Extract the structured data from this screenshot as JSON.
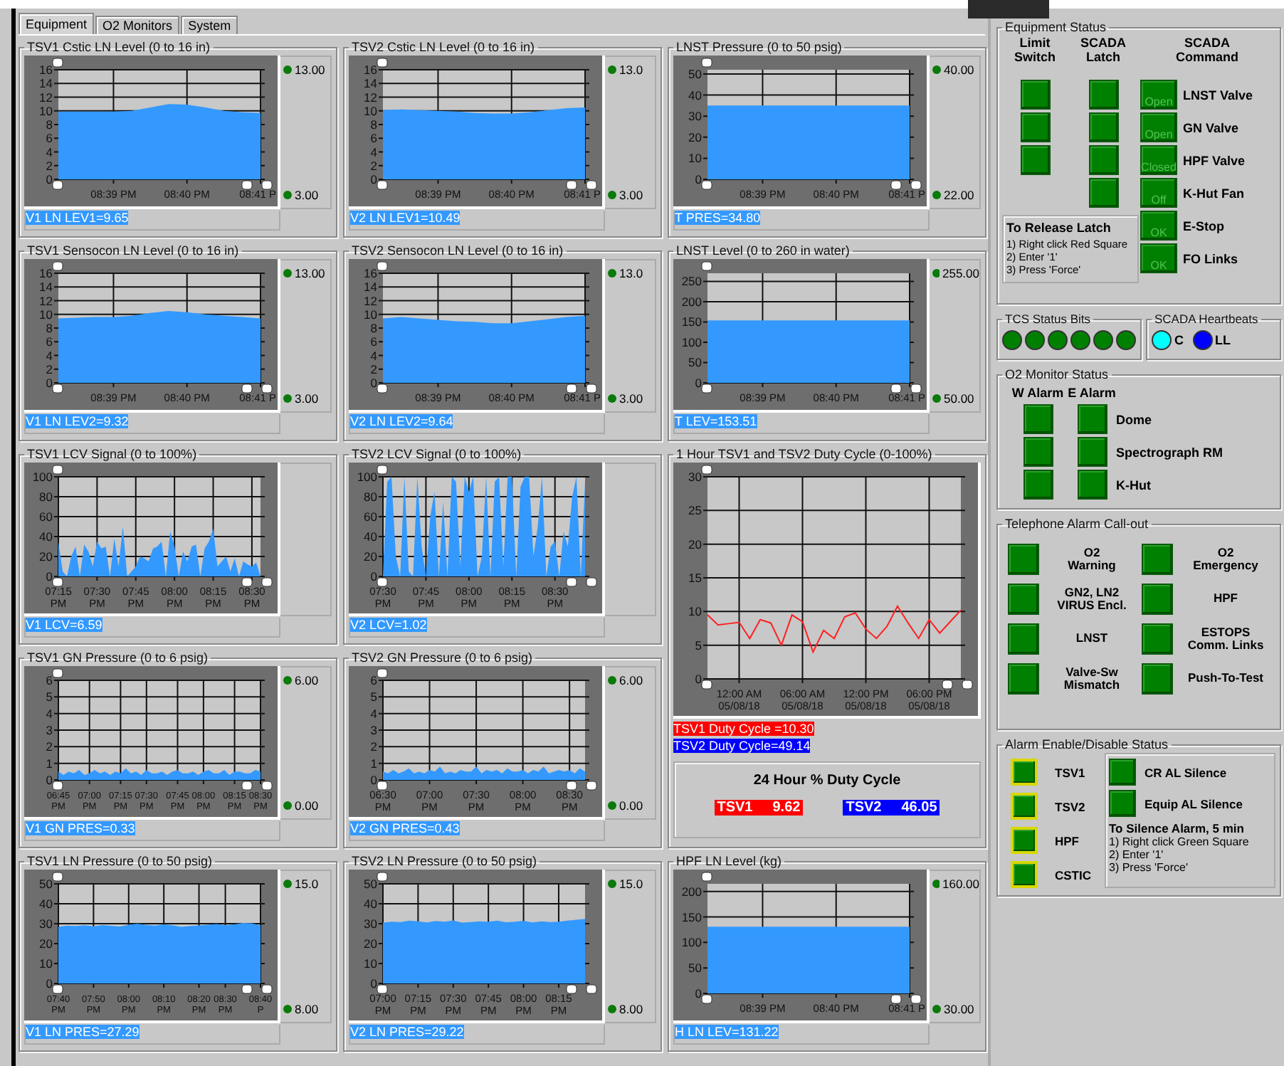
{
  "tabs": [
    {
      "label": "Equipment",
      "selected": true
    },
    {
      "label": "O2 Monitors",
      "selected": false
    },
    {
      "label": "System",
      "selected": false
    }
  ],
  "columns": [
    [
      {
        "kind": "trend",
        "title": "TSV1 Cstic LN Level (0 to 16 in)",
        "high_limit": "13.00",
        "low_limit": "3.00",
        "readout": "V1 LN LEV1=9.65",
        "chart_data": {
          "type": "area",
          "grid": true,
          "categories": [
            null,
            null,
            null,
            "08:39 PM",
            null,
            null,
            null,
            "08:40 PM",
            null,
            null,
            null,
            "08:41 P"
          ],
          "values": [
            9.9,
            9.9,
            9.9,
            9.9,
            10,
            10.5,
            11,
            10.9,
            10.5,
            10,
            9.8,
            9.7
          ],
          "ylim": [
            0,
            16
          ],
          "yticks": [
            0,
            2,
            4,
            6,
            8,
            10,
            12,
            14,
            16
          ]
        }
      },
      {
        "kind": "trend",
        "title": "TSV1 Sensocon LN Level (0 to 16 in)",
        "high_limit": "13.00",
        "low_limit": "3.00",
        "readout": "V1 LN LEV2=9.32",
        "chart_data": {
          "type": "area",
          "grid": true,
          "categories": [
            null,
            null,
            null,
            "08:39 PM",
            null,
            null,
            null,
            "08:40 PM",
            null,
            null,
            null,
            "08:41 P"
          ],
          "values": [
            9.4,
            9.5,
            9.6,
            9.6,
            9.8,
            10.2,
            10.5,
            10.3,
            10,
            9.8,
            9.6,
            9.4
          ],
          "ylim": [
            0,
            16
          ],
          "yticks": [
            0,
            2,
            4,
            6,
            8,
            10,
            12,
            14,
            16
          ]
        }
      },
      {
        "kind": "trend",
        "title": "TSV1 LCV Signal (0 to 100%)",
        "readout": "V1 LCV=6.59",
        "chart_data": {
          "type": "area",
          "grid": true,
          "categories": [
            "07:15 PM",
            null,
            null,
            null,
            null,
            null,
            null,
            null,
            null,
            "07:30 PM",
            null,
            null,
            null,
            null,
            null,
            null,
            null,
            null,
            "07:45 PM",
            null,
            null,
            null,
            null,
            null,
            null,
            null,
            null,
            "08:00 PM",
            null,
            null,
            null,
            null,
            null,
            null,
            null,
            null,
            "08:15 PM",
            null,
            null,
            null,
            null,
            null,
            null,
            null,
            null,
            "08:30 PM",
            null,
            null
          ],
          "values": [
            35,
            5,
            0,
            20,
            30,
            0,
            32,
            25,
            10,
            35,
            28,
            30,
            0,
            38,
            10,
            50,
            0,
            5,
            10,
            20,
            18,
            15,
            28,
            30,
            35,
            0,
            45,
            30,
            0,
            25,
            15,
            30,
            32,
            0,
            28,
            35,
            48,
            10,
            15,
            20,
            5,
            18,
            0,
            15,
            12,
            10,
            14,
            0
          ],
          "ylim": [
            0,
            100
          ],
          "yticks": [
            0,
            20,
            40,
            60,
            80,
            100
          ]
        }
      },
      {
        "kind": "trend",
        "title": "TSV1 GN Pressure (0 to 6 psig)",
        "high_limit": "6.00",
        "low_limit": "0.00",
        "readout": "V1 GN PRES=0.33",
        "chart_data": {
          "type": "area",
          "grid": true,
          "categories": [
            "06:45 PM",
            null,
            null,
            null,
            null,
            null,
            "07:00 PM",
            null,
            null,
            null,
            null,
            null,
            "07:15 PM",
            null,
            null,
            null,
            null,
            "07:30 PM",
            null,
            null,
            null,
            null,
            null,
            "07:45 PM",
            null,
            null,
            null,
            null,
            "08:00 PM",
            null,
            null,
            null,
            null,
            null,
            "08:15 PM",
            null,
            null,
            null,
            null,
            "08:30 PM"
          ],
          "values": [
            0.5,
            0.3,
            0.5,
            0.4,
            0.6,
            0.3,
            0.4,
            0.6,
            0.4,
            0.5,
            0.3,
            0.5,
            0.4,
            0.7,
            0.4,
            0.5,
            0.3,
            0.6,
            0.4,
            0.4,
            0.5,
            0.3,
            0.5,
            0.6,
            0.4,
            0.4,
            0.5,
            0.3,
            0.5,
            0.6,
            0.4,
            0.4,
            0.6,
            0.3,
            0.5,
            0.5,
            0.4,
            0.4,
            0.6,
            0.5
          ],
          "ylim": [
            0,
            6
          ],
          "yticks": [
            0,
            1,
            2,
            3,
            4,
            5,
            6
          ]
        }
      },
      {
        "kind": "trend",
        "title": "TSV1 LN Pressure (0 to 50 psig)",
        "high_limit": "15.0",
        "low_limit": "8.00",
        "readout": "V1 LN PRES=27.29",
        "chart_data": {
          "type": "area",
          "grid": true,
          "categories": [
            "07:40 PM",
            null,
            null,
            null,
            "07:50 PM",
            null,
            null,
            null,
            "08:00 PM",
            null,
            null,
            null,
            "08:10 PM",
            null,
            null,
            null,
            "08:20 PM",
            null,
            null,
            "08:30 PM",
            null,
            null,
            null,
            "08:40 P"
          ],
          "values": [
            28.5,
            29,
            28.8,
            29.2,
            28.7,
            29.3,
            28.9,
            28.6,
            29.5,
            30,
            29.4,
            29,
            29.6,
            29.2,
            28.4,
            28.8,
            29.1,
            29.5,
            29.8,
            29.3,
            29.6,
            30.4,
            30.2,
            29.2
          ],
          "ylim": [
            0,
            50
          ],
          "yticks": [
            0,
            10,
            20,
            30,
            40,
            50
          ]
        }
      }
    ],
    [
      {
        "kind": "trend",
        "title": "TSV2 Cstic LN Level (0 to 16 in)",
        "high_limit": "13.0",
        "low_limit": "3.00",
        "readout": "V2 LN LEV1=10.49",
        "chart_data": {
          "type": "area",
          "grid": true,
          "categories": [
            null,
            null,
            null,
            "08:39 PM",
            null,
            null,
            null,
            "08:40 PM",
            null,
            null,
            null,
            "08:41 P"
          ],
          "values": [
            10.1,
            10.2,
            10.1,
            10,
            9.9,
            9.7,
            9.6,
            9.6,
            9.8,
            10.1,
            10.4,
            10.5
          ],
          "ylim": [
            0,
            16
          ],
          "yticks": [
            0,
            2,
            4,
            6,
            8,
            10,
            12,
            14,
            16
          ]
        }
      },
      {
        "kind": "trend",
        "title": "TSV2 Sensocon LN Level (0 to 16 in)",
        "high_limit": "13.0",
        "low_limit": "3.00",
        "readout": "V2 LN LEV2=9.64",
        "chart_data": {
          "type": "area",
          "grid": true,
          "categories": [
            null,
            null,
            null,
            "08:39 PM",
            null,
            null,
            null,
            "08:40 PM",
            null,
            null,
            null,
            "08:41 P"
          ],
          "values": [
            9.4,
            9.6,
            9.4,
            9.2,
            9,
            8.9,
            8.7,
            8.7,
            9,
            9.3,
            9.6,
            9.8
          ],
          "ylim": [
            0,
            16
          ],
          "yticks": [
            0,
            2,
            4,
            6,
            8,
            10,
            12,
            14,
            16
          ]
        }
      },
      {
        "kind": "trend",
        "title": "TSV2 LCV Signal (0 to 100%)",
        "readout": "V2 LCV=1.02",
        "chart_data": {
          "type": "area",
          "grid": true,
          "categories": [
            "07:30 PM",
            null,
            null,
            null,
            null,
            null,
            null,
            null,
            null,
            null,
            "07:45 PM",
            null,
            null,
            null,
            null,
            null,
            null,
            null,
            null,
            null,
            "08:00 PM",
            null,
            null,
            null,
            null,
            null,
            null,
            null,
            null,
            null,
            "08:15 PM",
            null,
            null,
            null,
            null,
            null,
            null,
            null,
            null,
            null,
            "08:30 PM",
            null,
            null,
            null,
            null,
            null,
            null,
            null
          ],
          "values": [
            0,
            95,
            100,
            20,
            0,
            100,
            5,
            0,
            100,
            30,
            0,
            60,
            85,
            0,
            75,
            0,
            100,
            95,
            10,
            100,
            85,
            100,
            0,
            20,
            100,
            0,
            95,
            100,
            10,
            100,
            100,
            0,
            90,
            100,
            100,
            20,
            50,
            100,
            0,
            30,
            35,
            0,
            45,
            30,
            80,
            100,
            0,
            95
          ],
          "ylim": [
            0,
            100
          ],
          "yticks": [
            0,
            20,
            40,
            60,
            80,
            100
          ]
        }
      },
      {
        "kind": "trend",
        "title": "TSV2 GN Pressure (0 to 6 psig)",
        "high_limit": "6.00",
        "low_limit": "0.00",
        "readout": "V2 GN PRES=0.43",
        "chart_data": {
          "type": "area",
          "grid": true,
          "categories": [
            "06:30 PM",
            null,
            null,
            null,
            null,
            null,
            null,
            null,
            null,
            "07:00 PM",
            null,
            null,
            null,
            null,
            null,
            null,
            null,
            null,
            "07:30 PM",
            null,
            null,
            null,
            null,
            null,
            null,
            null,
            null,
            "08:00 PM",
            null,
            null,
            null,
            null,
            null,
            null,
            null,
            null,
            "08:30 PM",
            null,
            null,
            null
          ],
          "values": [
            0.5,
            0.4,
            0.6,
            0.4,
            0.5,
            0.7,
            0.4,
            0.5,
            0.4,
            0.6,
            0.5,
            0.8,
            0.4,
            0.5,
            0.4,
            0.6,
            0.5,
            0.5,
            0.8,
            0.4,
            0.6,
            0.5,
            0.6,
            0.4,
            0.7,
            0.5,
            0.5,
            0.6,
            0.4,
            0.6,
            0.5,
            0.8,
            0.4,
            0.5,
            0.6,
            0.5,
            0.6,
            0.4,
            0.7,
            0.5
          ],
          "ylim": [
            0,
            6
          ],
          "yticks": [
            0,
            1,
            2,
            3,
            4,
            5,
            6
          ]
        }
      },
      {
        "kind": "trend",
        "title": "TSV2 LN Pressure (0 to 50 psig)",
        "high_limit": "15.0",
        "low_limit": "8.00",
        "readout": "V2 LN PRES=29.22",
        "chart_data": {
          "type": "area",
          "grid": true,
          "categories": [
            "07:00 PM",
            null,
            null,
            null,
            "07:15 PM",
            null,
            null,
            null,
            "07:30 PM",
            null,
            null,
            null,
            "07:45 PM",
            null,
            null,
            null,
            "08:00 PM",
            null,
            null,
            null,
            "08:15 PM",
            null,
            null,
            null
          ],
          "values": [
            30.5,
            31,
            30.8,
            31.5,
            31.2,
            30.6,
            31.3,
            31,
            31.6,
            30.5,
            30.8,
            31.2,
            31,
            31.5,
            30.7,
            31,
            31.4,
            30.6,
            31.2,
            30.8,
            31,
            31.5,
            32,
            32.4
          ],
          "ylim": [
            0,
            50
          ],
          "yticks": [
            0,
            10,
            20,
            30,
            40,
            50
          ]
        }
      }
    ],
    [
      {
        "kind": "trend",
        "title": "LNST Pressure (0 to 50 psig)",
        "high_limit": "40.00",
        "low_limit": "22.00",
        "readout": "T PRES=34.80",
        "chart_data": {
          "type": "area",
          "grid": true,
          "categories": [
            null,
            null,
            null,
            "08:39 PM",
            null,
            null,
            null,
            "08:40 PM",
            null,
            null,
            null,
            "08:41 P"
          ],
          "values": [
            35,
            35,
            35,
            35,
            35,
            35,
            35,
            35,
            35,
            35,
            35,
            35
          ],
          "ylim": [
            0,
            52
          ],
          "yticks": [
            0,
            10,
            20,
            30,
            40,
            50
          ]
        }
      },
      {
        "kind": "trend",
        "title": "LNST Level (0 to 260 in water)",
        "high_limit": "255.00",
        "low_limit": "50.00",
        "readout": "T LEV=153.51",
        "chart_data": {
          "type": "area",
          "grid": true,
          "categories": [
            null,
            null,
            null,
            "08:39 PM",
            null,
            null,
            null,
            "08:40 PM",
            null,
            null,
            null,
            "08:41 P"
          ],
          "values": [
            154,
            154,
            154,
            154,
            154,
            154,
            154,
            154,
            154,
            154,
            154,
            154
          ],
          "ylim": [
            0,
            270
          ],
          "yticks": [
            0,
            50,
            100,
            150,
            200,
            250
          ]
        }
      },
      {
        "kind": "duty_cycle",
        "title": "1 Hour TSV1 and TSV2 Duty Cycle (0-100%)",
        "chart_data": {
          "type": "line",
          "grid": true,
          "categories": [
            null,
            null,
            null,
            "12:00 AM\n05/08/18",
            null,
            null,
            null,
            null,
            null,
            "06:00 AM\n05/08/18",
            null,
            null,
            null,
            null,
            null,
            "12:00 PM\n05/08/18",
            null,
            null,
            null,
            null,
            null,
            "06:00 PM\n05/08/18",
            null,
            null,
            null
          ],
          "values": [
            9.5,
            8,
            8.2,
            8.4,
            6,
            8.8,
            8.3,
            5,
            9.5,
            8.5,
            4,
            7.2,
            6,
            9.2,
            9.8,
            7.4,
            6,
            7.8,
            10.8,
            8.3,
            6,
            8.8,
            6.8,
            8.5,
            10.2
          ],
          "ylim": [
            0,
            30
          ],
          "yticks": [
            0,
            5,
            10,
            15,
            20,
            25,
            30
          ]
        },
        "legend": [
          {
            "text": "TSV1 Duty Cycle =10.30",
            "color": "#ff0000"
          },
          {
            "text": "TSV2 Duty Cycle=49.14",
            "color": "#0000ff"
          }
        ],
        "summary": {
          "title": "24 Hour % Duty Cycle",
          "items": [
            {
              "name": "TSV1",
              "value": "9.62",
              "color": "#ff0000"
            },
            {
              "name": "TSV2",
              "value": "46.05",
              "color": "#0000ff"
            }
          ]
        }
      },
      {
        "kind": "trend",
        "title": "HPF LN Level (kg)",
        "high_limit": "160.00",
        "low_limit": "30.00",
        "readout": "H LN LEV=131.22",
        "chart_data": {
          "type": "area",
          "grid": true,
          "categories": [
            null,
            null,
            null,
            "08:39 PM",
            null,
            null,
            null,
            "08:40 PM",
            null,
            null,
            null,
            "08:41 P"
          ],
          "values": [
            131,
            131,
            131,
            131,
            131,
            131,
            131,
            131,
            131,
            131,
            131,
            131
          ],
          "ylim": [
            0,
            215
          ],
          "yticks": [
            0,
            50,
            100,
            150,
            200
          ]
        }
      }
    ]
  ],
  "equipment_status": {
    "title": "Equipment Status",
    "headers": [
      "Limit\nSwitch",
      "SCADA\nLatch",
      "SCADA\nCommand"
    ],
    "limit_switches": [
      {
        "on": true
      },
      {
        "on": true
      },
      {
        "on": true
      }
    ],
    "latches": [
      {
        "on": true
      },
      {
        "on": true
      },
      {
        "on": true
      },
      {
        "on": true
      }
    ],
    "commands": [
      {
        "state": "Open",
        "label": "LNST Valve"
      },
      {
        "state": "Open",
        "label": "GN Valve"
      },
      {
        "state": "Closed",
        "label": "HPF Valve"
      },
      {
        "state": "Off",
        "label": "K-Hut Fan"
      },
      {
        "state": "OK",
        "label": "E-Stop"
      },
      {
        "state": "OK",
        "label": "FO Links"
      }
    ],
    "note": {
      "title": "To Release Latch",
      "steps": [
        "1) Right click Red Square",
        "2) Enter '1'",
        "3) Press 'Force'"
      ]
    }
  },
  "tcs_status_bits": {
    "title": "TCS Status Bits",
    "bits": [
      {
        "on": true
      },
      {
        "on": true
      },
      {
        "on": true
      },
      {
        "on": true
      },
      {
        "on": true
      },
      {
        "on": true
      }
    ]
  },
  "scada_heartbeats": {
    "title": "SCADA Heartbeats",
    "items": [
      {
        "label": "C",
        "color": "#00ffff"
      },
      {
        "label": "LL",
        "color": "#0000ff"
      }
    ]
  },
  "o2_monitor_status": {
    "title": "O2 Monitor Status",
    "headers": [
      "W Alarm",
      "E Alarm"
    ],
    "rows": [
      {
        "label": "Dome",
        "w_alarm": true,
        "e_alarm": true
      },
      {
        "label": "Spectrograph RM",
        "w_alarm": true,
        "e_alarm": true
      },
      {
        "label": "K-Hut",
        "w_alarm": true,
        "e_alarm": true
      }
    ]
  },
  "telephone_alarm_callout": {
    "title": "Telephone Alarm Call-out",
    "items": [
      "O2\nWarning",
      "O2\nEmergency",
      "GN2, LN2\nVIRUS Encl.",
      "HPF",
      "LNST",
      "ESTOPS\nComm. Links",
      "Valve-Sw\nMismatch",
      "Push-To-Test"
    ]
  },
  "alarm_enable_status": {
    "title": "Alarm Enable/Disable Status",
    "alarms": [
      "TSV1",
      "TSV2",
      "HPF",
      "CSTIC"
    ],
    "silence": [
      "CR AL Silence",
      "Equip AL Silence"
    ],
    "note": {
      "title": "To Silence Alarm, 5 min",
      "steps": [
        "1) Right click Green Square",
        "2) Enter '1'",
        "3) Press 'Force'"
      ]
    }
  }
}
